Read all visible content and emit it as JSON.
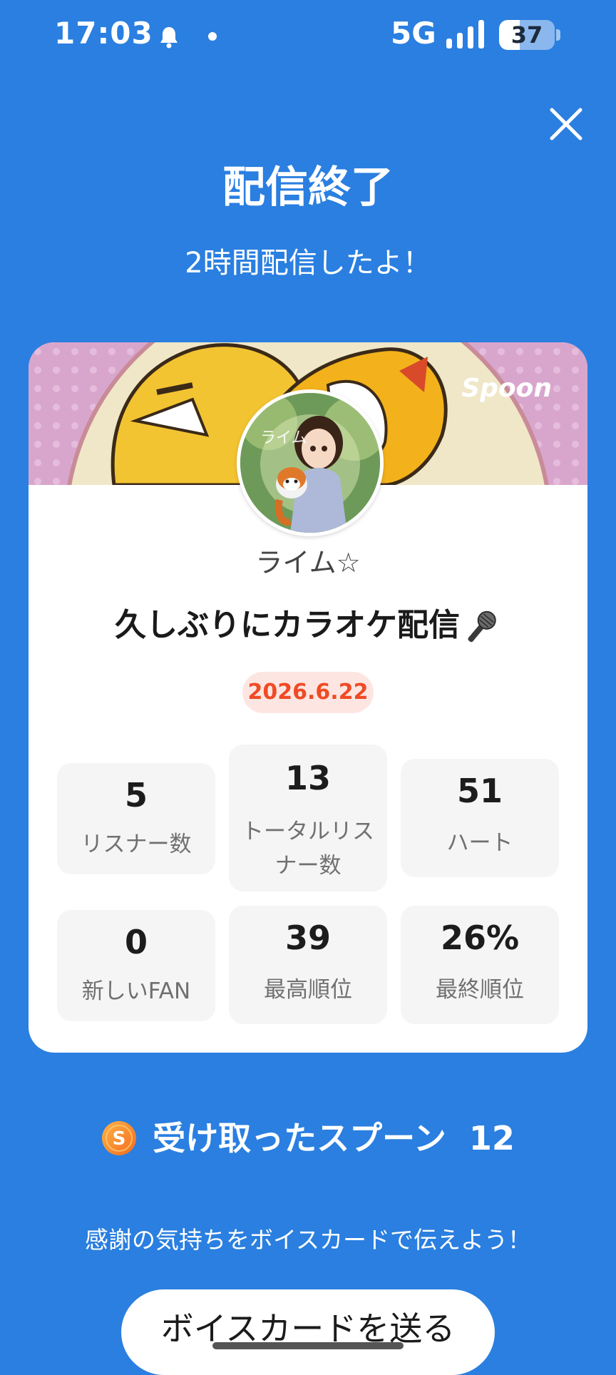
{
  "status_bar": {
    "time": "17:03",
    "network": "5G",
    "battery": "37",
    "battery_level": 0.37
  },
  "header": {
    "title": "配信終了",
    "subtitle": "2時間配信したよ！"
  },
  "card": {
    "brand": "Spoon",
    "username": "ライム☆",
    "live_title": "久しぶりにカラオケ配信",
    "date": "2026.6.22",
    "stats": [
      {
        "value": "5",
        "label": "リスナー数"
      },
      {
        "value": "13",
        "label": "トータルリスナー数"
      },
      {
        "value": "51",
        "label": "ハート"
      },
      {
        "value": "0",
        "label": "新しいFAN"
      },
      {
        "value": "39",
        "label": "最高順位"
      },
      {
        "value": "26%",
        "label": "最終順位"
      }
    ]
  },
  "spoons": {
    "label": "受け取ったスプーン",
    "count": "12"
  },
  "thanks_text": "感謝の気持ちをボイスカードで伝えよう！",
  "voice_card_button": "ボイスカードを送る",
  "colors": {
    "background": "#2a7fe0",
    "date_badge_text": "#f04a24",
    "date_badge_bg": "#fde6e2"
  },
  "icons": [
    "bell-icon",
    "signal-icon",
    "battery-icon",
    "close-icon",
    "microphone-icon",
    "spoon-coin-icon"
  ]
}
